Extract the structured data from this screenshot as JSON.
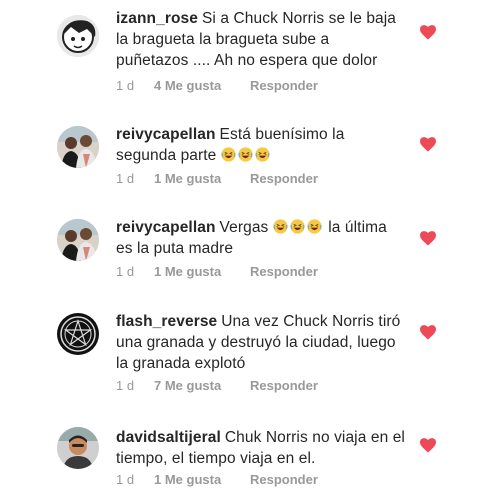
{
  "comments": [
    {
      "username": "izann_rose",
      "text": "Si a Chuck Norris se le baja la bragueta la bragueta sube a puñetazos .... Ah no espera que dolor",
      "time": "1 d",
      "likes": "4 Me gusta",
      "reply": "Responder"
    },
    {
      "username": "reivycapellan",
      "text": "Está buenísimo la segunda parte",
      "emojis": [
        "laughing-emoji",
        "laughing-emoji",
        "laughing-emoji"
      ],
      "time": "1 d",
      "likes": "1 Me gusta",
      "reply": "Responder"
    },
    {
      "username": "reivycapellan",
      "text_before": "Vergas",
      "emojis": [
        "laughing-emoji",
        "laughing-emoji",
        "laughing-emoji"
      ],
      "text_after": "la última es la puta madre",
      "time": "1 d",
      "likes": "1 Me gusta",
      "reply": "Responder"
    },
    {
      "username": "flash_reverse",
      "text": "Una vez Chuck Norris tiró una granada y destruyó la ciudad, luego la granada explotó",
      "time": "1 d",
      "likes": "7 Me gusta",
      "reply": "Responder"
    },
    {
      "username": "davidsaltijeral",
      "text": "Chuk Norris no viaja en el tiempo, el tiempo viaja en el.",
      "time": "1 d",
      "likes": "1 Me gusta",
      "reply": "Responder"
    }
  ],
  "colors": {
    "heart": "#ed4956",
    "meta": "#999999",
    "text": "#262626"
  }
}
